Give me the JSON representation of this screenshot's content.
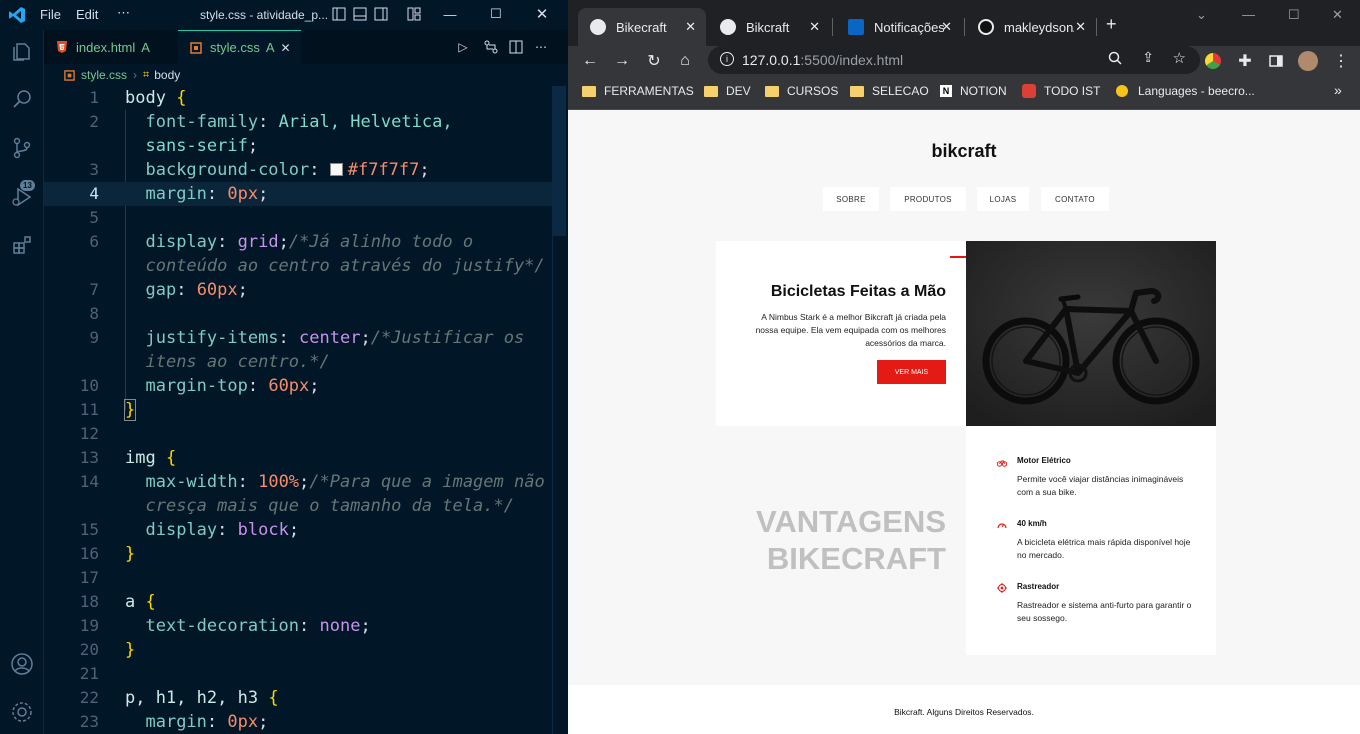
{
  "vscode": {
    "menu": [
      "File",
      "Edit",
      "⋯"
    ],
    "window_title": "style.css - atividade_p...",
    "tabs": [
      {
        "label": "index.html",
        "status": "A"
      },
      {
        "label": "style.css",
        "status": "A"
      }
    ],
    "breadcrumb": {
      "file": "style.css",
      "symbol": "body"
    },
    "scm_badge": "13",
    "lines": [
      {
        "n": "1"
      },
      {
        "n": "2"
      },
      {
        "n": ""
      },
      {
        "n": "3"
      },
      {
        "n": "4"
      },
      {
        "n": "5"
      },
      {
        "n": "6"
      },
      {
        "n": ""
      },
      {
        "n": "7"
      },
      {
        "n": "8"
      },
      {
        "n": "9"
      },
      {
        "n": ""
      },
      {
        "n": "10"
      },
      {
        "n": "11"
      },
      {
        "n": "12"
      },
      {
        "n": "13"
      },
      {
        "n": "14"
      },
      {
        "n": ""
      },
      {
        "n": "15"
      },
      {
        "n": "16"
      },
      {
        "n": "17"
      },
      {
        "n": "18"
      },
      {
        "n": "19"
      },
      {
        "n": "20"
      },
      {
        "n": "21"
      },
      {
        "n": "22"
      },
      {
        "n": "23"
      }
    ],
    "code": {
      "l1_sel": "body",
      "l1_br": "{",
      "l2_prop": "font-family",
      "l2_val": "Arial, Helvetica,",
      "l2b_val": "sans-serif",
      "l3_prop": "background-color",
      "l3_val": "#f7f7f7",
      "l4_prop": "margin",
      "l4_num": "0px",
      "l6_prop": "display",
      "l6_val": "grid",
      "l6_cm": "/*Já alinho todo o",
      "l6b_cm": "conteúdo ao centro através do justify*/",
      "l7_prop": "gap",
      "l7_num": "60px",
      "l9_prop": "justify-items",
      "l9_val": "center",
      "l9_cm": "/*Justificar os",
      "l9b_cm": "itens ao centro.*/",
      "l10_prop": "margin-top",
      "l10_num": "60px",
      "l11_br": "}",
      "l13_sel": "img",
      "l13_br": "{",
      "l14_prop": "max-width",
      "l14_num": "100%",
      "l14_cm": "/*Para que a imagem não",
      "l14b_cm": "cresça mais que o tamanho da tela.*/",
      "l15_prop": "display",
      "l15_val": "block",
      "l16_br": "}",
      "l18_sel": "a",
      "l18_br": "{",
      "l19_prop": "text-decoration",
      "l19_val": "none",
      "l20_br": "}",
      "l22_sel": "p, h1, h2, h3",
      "l22_br": "{",
      "l23_prop": "margin",
      "l23_num": "0px"
    }
  },
  "browser": {
    "tabs": [
      {
        "label": "Bikecraft",
        "active": true
      },
      {
        "label": "Bikcraft",
        "active": false
      },
      {
        "label": "Notificações",
        "active": false
      },
      {
        "label": "makleydson/",
        "active": false
      }
    ],
    "url_host": "127.0.0.1",
    "url_rest": ":5500/index.html",
    "bookmarks": [
      "FERRAMENTAS",
      "DEV",
      "CURSOS",
      "SELECAO",
      "NOTION",
      "TODO IST",
      "Languages - beecro..."
    ],
    "bookmarks_more": "»"
  },
  "site": {
    "title": "bikcraft",
    "nav": [
      "SOBRE",
      "PRODUTOS",
      "LOJAS",
      "CONTATO"
    ],
    "hero": {
      "heading": "Bicicletas Feitas a Mão",
      "text": "A Nimbus Stark é a melhor Bikcraft já criada pela nossa equipe. Ela vem equipada com os melhores acessórios da marca.",
      "button": "VER MAIS"
    },
    "vantagens_title": [
      "VANTAGENS",
      "BIKECRAFT"
    ],
    "items": [
      {
        "title": "Motor Elétrico",
        "text": "Permite você viajar distâncias inimagináveis com a sua bike."
      },
      {
        "title": "40 km/h",
        "text": "A bicicleta elétrica mais rápida disponível hoje no mercado."
      },
      {
        "title": "Rastreador",
        "text": "Rastreador e sistema anti-furto para garantir o seu sossego."
      }
    ],
    "footer": "Bikcraft. Alguns Direitos Reservados."
  },
  "colors": {
    "accent_red": "#e31b14",
    "editor_bg": "#011627"
  }
}
